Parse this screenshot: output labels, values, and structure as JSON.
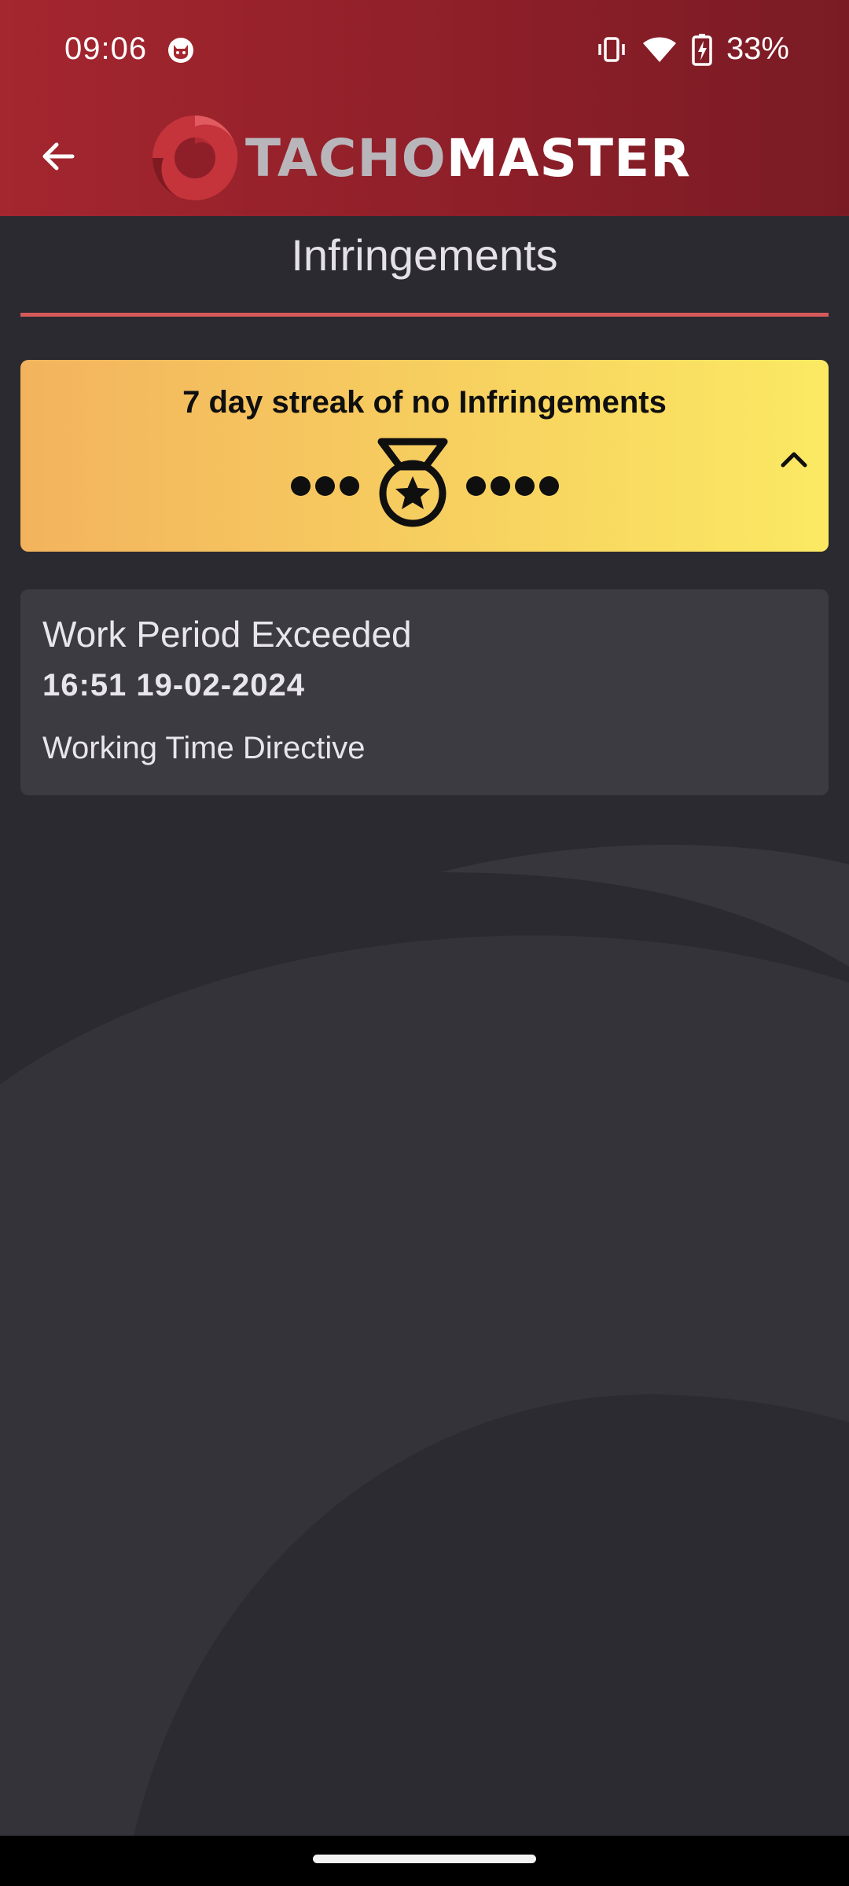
{
  "status_bar": {
    "time": "09:06",
    "battery_percent": "33%",
    "icons": [
      "cat-notification-icon",
      "vibrate-icon",
      "wifi-icon",
      "battery-charging-icon"
    ]
  },
  "header": {
    "back_icon": "arrow-left-icon",
    "brand_part1": "TACHO",
    "brand_part2": "MASTER"
  },
  "page": {
    "title": "Infringements"
  },
  "streak": {
    "title": "7 day streak of no Infringements",
    "dots_before": 3,
    "dots_after": 4,
    "icon": "medal-icon",
    "toggle_icon": "chevron-up-icon"
  },
  "infringements": [
    {
      "title": "Work Period Exceeded",
      "datetime": "16:51 19-02-2024",
      "category": "Working Time Directive"
    }
  ],
  "colors": {
    "header": "#a4262f",
    "background": "#2b2a30",
    "underline": "#d65a5a",
    "streak_start": "#f3b35e",
    "streak_end": "#fbe963",
    "card": "#3c3b42"
  }
}
